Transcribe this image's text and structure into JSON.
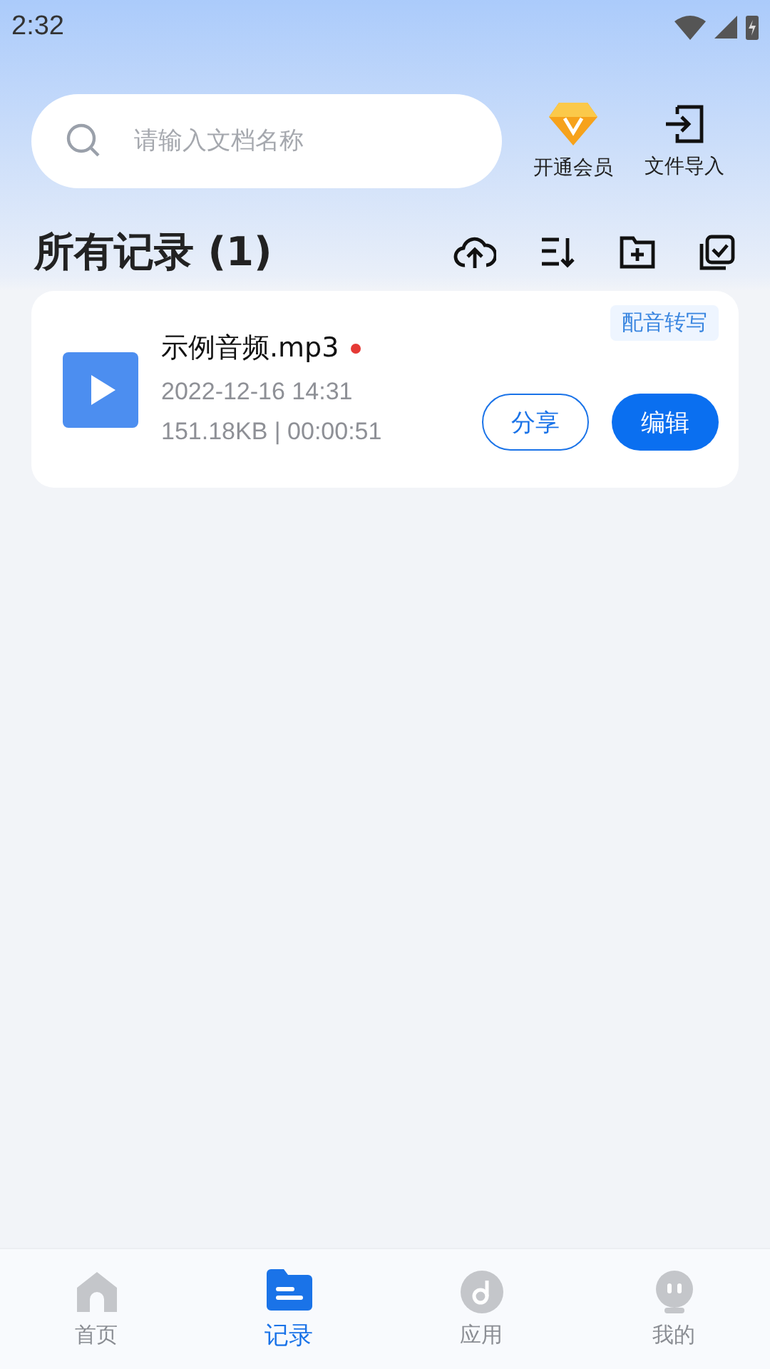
{
  "status_bar": {
    "time": "2:32"
  },
  "search": {
    "placeholder": "请输入文档名称"
  },
  "header_actions": [
    {
      "kind": "vip",
      "label": "开通会员"
    },
    {
      "kind": "import",
      "label": "文件导入"
    }
  ],
  "section": {
    "title": "所有记录 (1)"
  },
  "records": [
    {
      "name": "示例音频.mp3",
      "unread": true,
      "tag": "配音转写",
      "date": "2022-12-16 14:31",
      "meta": "151.18KB | 00:00:51",
      "buttons": [
        {
          "label": "分享",
          "kind": "outline"
        },
        {
          "label": "编辑",
          "kind": "filled"
        }
      ]
    }
  ],
  "tabs": [
    {
      "label": "首页",
      "selected": false
    },
    {
      "label": "记录",
      "selected": true
    },
    {
      "label": "应用",
      "selected": false
    },
    {
      "label": "我的",
      "selected": false
    }
  ]
}
